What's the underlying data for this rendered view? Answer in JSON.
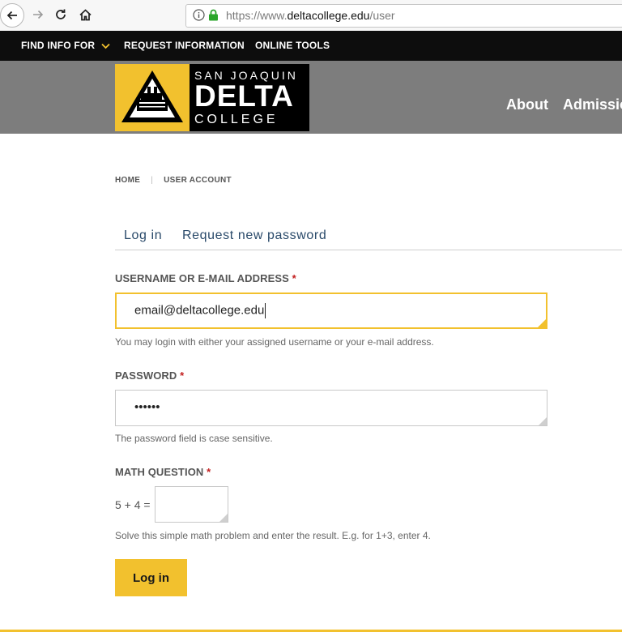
{
  "browser": {
    "url_prefix": "https://www.",
    "url_host": "deltacollege.edu",
    "url_path": "/user"
  },
  "topnav": {
    "items": [
      {
        "label": "FIND INFO FOR"
      },
      {
        "label": "REQUEST INFORMATION"
      },
      {
        "label": "ONLINE TOOLS"
      }
    ]
  },
  "logo": {
    "line1": "SAN JOAQUIN",
    "line2": "DELTA",
    "line3": "COLLEGE"
  },
  "main_nav": [
    {
      "label": "About"
    },
    {
      "label": "Admission"
    }
  ],
  "breadcrumb": {
    "home": "HOME",
    "current": "USER ACCOUNT"
  },
  "tabs": [
    {
      "label": "Log in"
    },
    {
      "label": "Request new password"
    }
  ],
  "form": {
    "username": {
      "label": "USERNAME OR E-MAIL ADDRESS",
      "required_mark": "*",
      "value": "email@deltacollege.edu",
      "help": "You may login with either your assigned username or your e-mail address."
    },
    "password": {
      "label": "PASSWORD",
      "required_mark": "*",
      "value": "••••••",
      "help": "The password field is case sensitive."
    },
    "math": {
      "label": "MATH QUESTION",
      "required_mark": "*",
      "question": "5 + 4 =",
      "value": "",
      "help": "Solve this simple math problem and enter the result. E.g. for 1+3, enter 4."
    },
    "submit_label": "Log in"
  },
  "colors": {
    "accent": "#f2c12e",
    "topnav_bg": "#0d0d0d",
    "header_bg": "#7d7d7d",
    "required": "#c32020",
    "tab_text": "#2a4a6a"
  }
}
